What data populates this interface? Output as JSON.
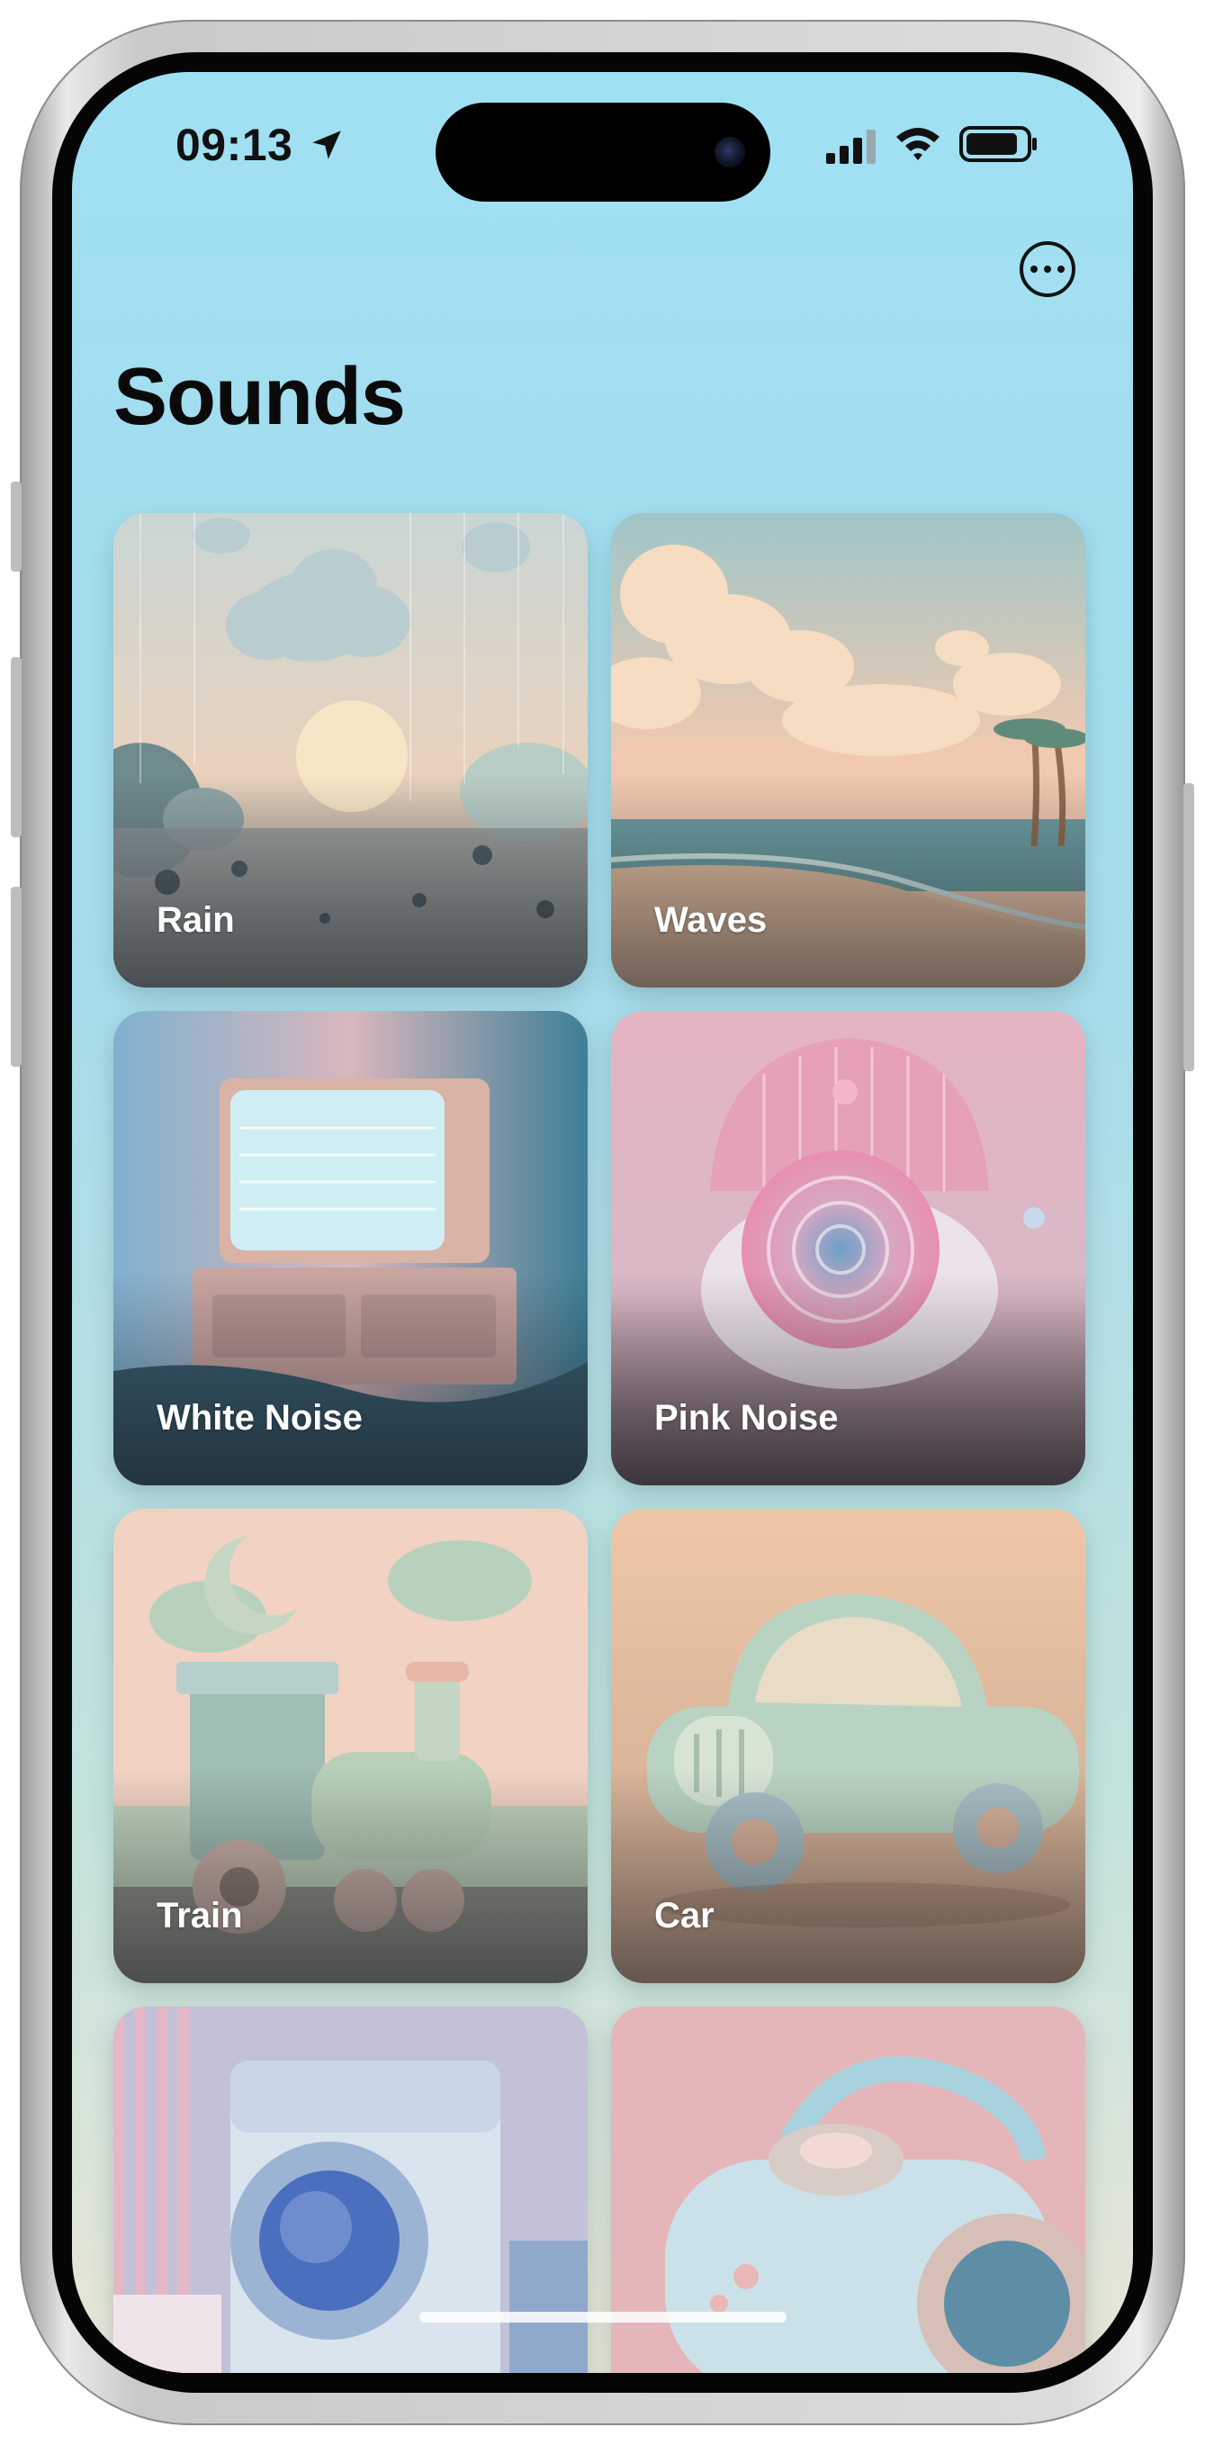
{
  "status_bar": {
    "time": "09:13",
    "icons": [
      "location-arrow-icon",
      "cellular-signal-icon",
      "wifi-icon",
      "battery-icon"
    ]
  },
  "header": {
    "more_icon": "ellipsis-circle-icon",
    "title": "Sounds"
  },
  "sounds": [
    {
      "label": "Rain",
      "art": "rain-clouds-scene"
    },
    {
      "label": "Waves",
      "art": "beach-waves-scene"
    },
    {
      "label": "White Noise",
      "art": "static-tv-scene"
    },
    {
      "label": "Pink Noise",
      "art": "pink-rose-scene"
    },
    {
      "label": "Train",
      "art": "toy-train-scene"
    },
    {
      "label": "Car",
      "art": "toy-car-scene"
    },
    {
      "label": "",
      "art": "washing-machine-scene"
    },
    {
      "label": "",
      "art": "vacuum-cleaner-scene"
    }
  ],
  "colors": {
    "background_top": "#9fe0f3",
    "background_bottom": "#e7e6d6",
    "title": "#0a0a0a",
    "card_label": "#ffffff"
  }
}
